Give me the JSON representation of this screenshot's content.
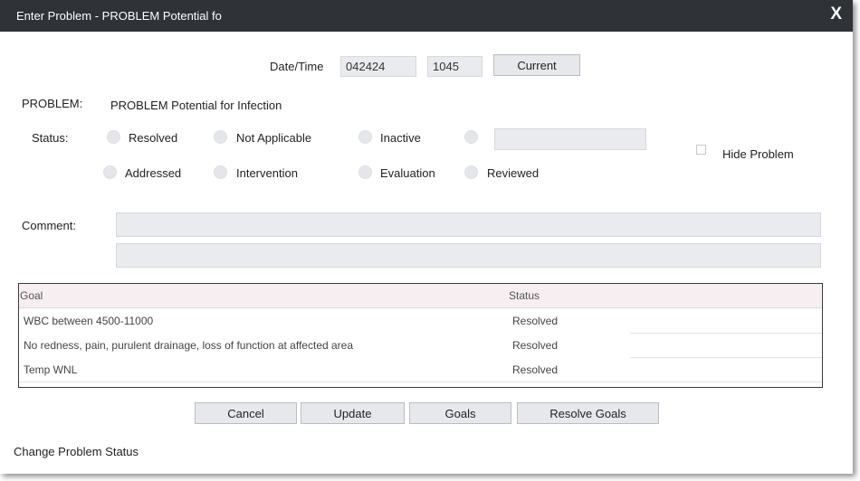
{
  "window": {
    "title": "Enter Problem - PROBLEM Potential fo",
    "close_label": "X"
  },
  "datetime": {
    "label": "Date/Time",
    "date_value": "042424",
    "time_value": "1045",
    "current_button": "Current"
  },
  "problem": {
    "label": "PROBLEM:",
    "value": "PROBLEM Potential for Infection"
  },
  "status": {
    "label": "Status:",
    "options": [
      "Resolved",
      "Not Applicable",
      "Inactive",
      "Addressed",
      "Intervention",
      "Evaluation",
      "Reviewed"
    ],
    "other_value": "",
    "hide_problem_label": "Hide Problem"
  },
  "comment": {
    "label": "Comment:",
    "line1": "",
    "line2": ""
  },
  "goals": {
    "headers": {
      "goal": "Goal",
      "status": "Status"
    },
    "rows": [
      {
        "goal": "WBC between 4500-11000",
        "status": "Resolved"
      },
      {
        "goal": "No redness, pain, purulent drainage, loss of function at affected area",
        "status": "Resolved"
      },
      {
        "goal": "Temp WNL",
        "status": "Resolved"
      }
    ]
  },
  "buttons": {
    "cancel": "Cancel",
    "update": "Update",
    "goals": "Goals",
    "resolve_goals": "Resolve Goals"
  },
  "footer": {
    "status_text": "Change Problem Status"
  },
  "colors": {
    "titlebar": "#2f3237",
    "field_bg": "#e9ebee",
    "table_header_bg": "#f6eef0"
  }
}
